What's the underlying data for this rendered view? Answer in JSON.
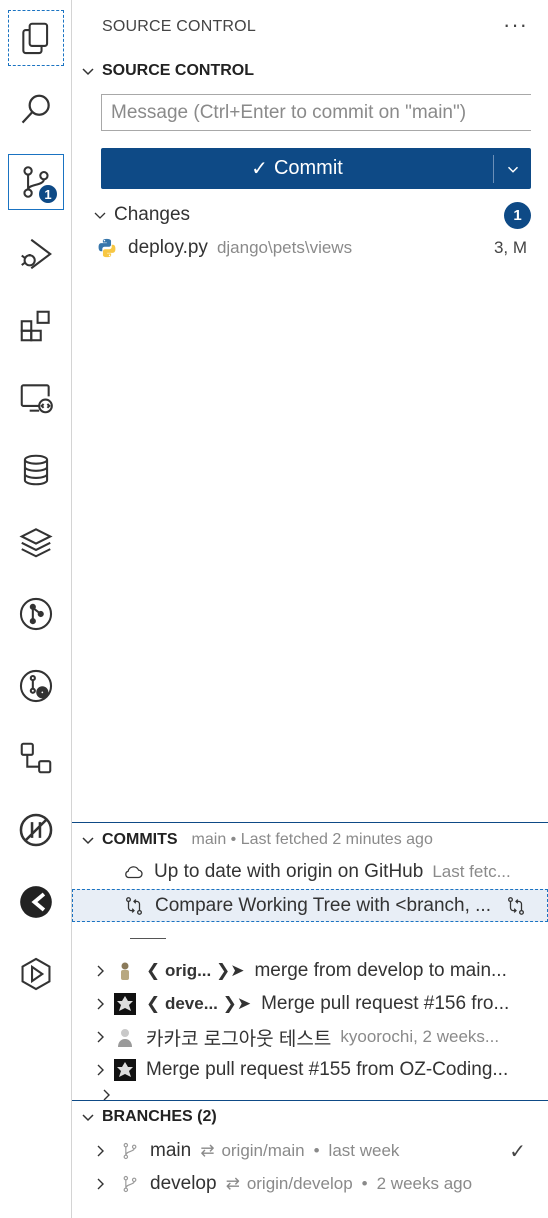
{
  "activity_bar": {
    "items": [
      {
        "name": "explorer"
      },
      {
        "name": "search"
      },
      {
        "name": "source-control",
        "badge": "1"
      },
      {
        "name": "run-debug"
      },
      {
        "name": "extensions"
      },
      {
        "name": "remote-explorer"
      },
      {
        "name": "database"
      },
      {
        "name": "layers"
      },
      {
        "name": "git-graph"
      },
      {
        "name": "git-history"
      },
      {
        "name": "flow"
      },
      {
        "name": "disable"
      },
      {
        "name": "gitlens"
      },
      {
        "name": "play-hex"
      }
    ]
  },
  "panel": {
    "header": "SOURCE CONTROL",
    "more_label": "···"
  },
  "source_control": {
    "title": "SOURCE CONTROL",
    "message_placeholder": "Message (Ctrl+Enter to commit on \"main\")",
    "commit_check": "✓",
    "commit_label": "Commit",
    "changes": {
      "label": "Changes",
      "count": "1",
      "files": [
        {
          "name": "deploy.py",
          "path": "django\\pets\\views",
          "status": "3, M"
        }
      ]
    }
  },
  "commits": {
    "title": "COMMITS",
    "subtitle": "main • Last fetched 2 minutes ago",
    "status_row": {
      "text": "Up to date with origin on GitHub",
      "detail": "Last fetc..."
    },
    "compare_row": {
      "text": "Compare Working Tree with <branch, ..."
    },
    "items": [
      {
        "tag": "❮ orig... ❯➤",
        "message": "merge from develop to main...",
        "detail": ""
      },
      {
        "tag": "❮ deve... ❯➤",
        "message": "Merge pull request #156 fro...",
        "detail": ""
      },
      {
        "tag": "",
        "message": "카카코 로그아웃 테스트",
        "detail": "kyoorochi, 2 weeks..."
      },
      {
        "tag": "",
        "message": "Merge pull request #155 from OZ-Coding...",
        "detail": ""
      }
    ]
  },
  "branches": {
    "title": "BRANCHES (2)",
    "items": [
      {
        "name": "main",
        "arrow": "⇄",
        "remote": "origin/main",
        "dot": "•",
        "time": "last week",
        "current_mark": "✓"
      },
      {
        "name": "develop",
        "arrow": "⇄",
        "remote": "origin/develop",
        "dot": "•",
        "time": "2 weeks ago",
        "current_mark": ""
      }
    ]
  },
  "colors": {
    "accent": "#0e4a86",
    "focus_border": "#1a73c2",
    "muted_text": "#8a8a8a"
  }
}
